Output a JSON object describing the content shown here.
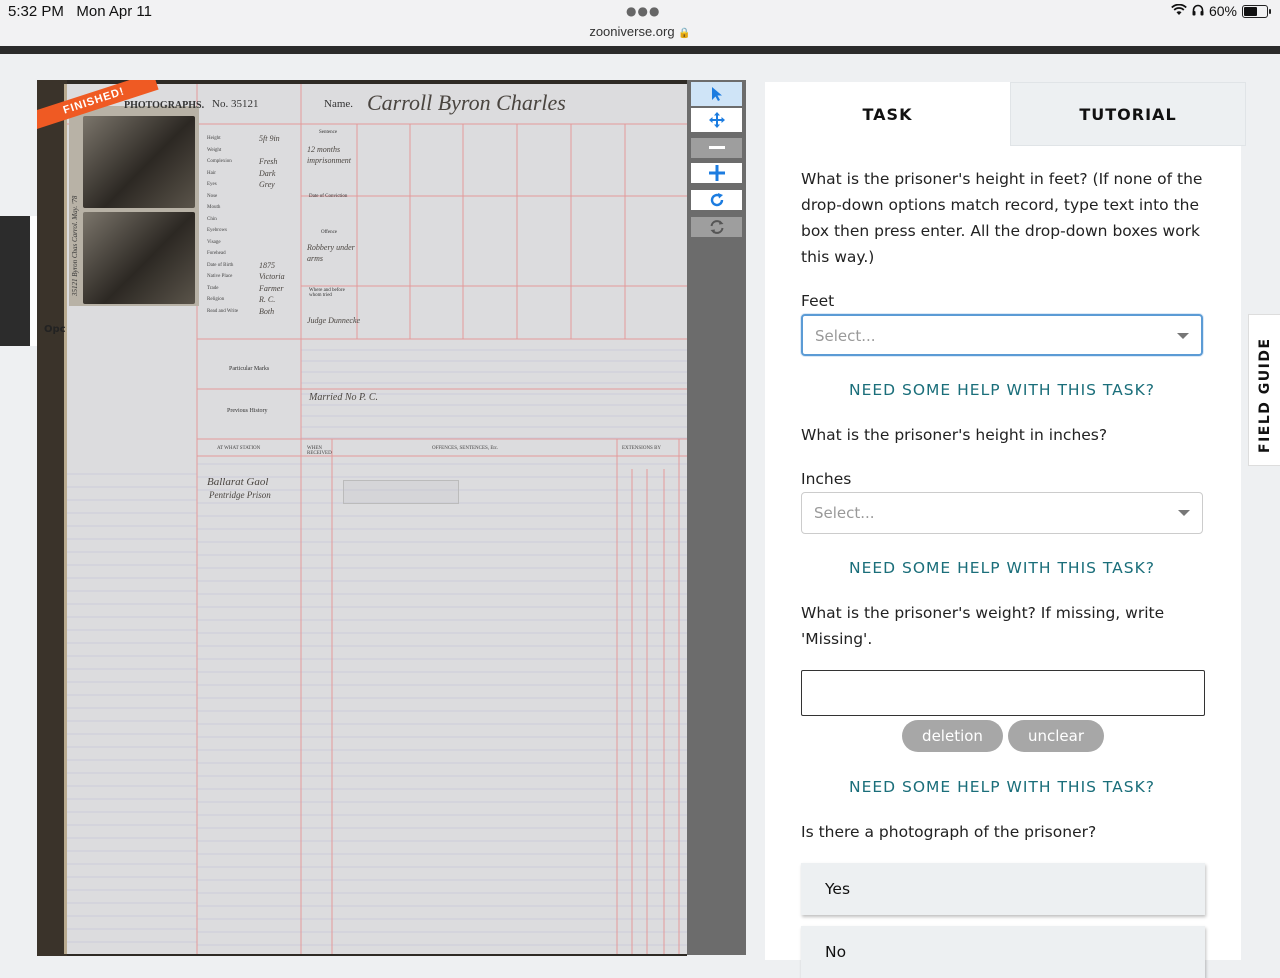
{
  "status_bar": {
    "time": "5:32 PM",
    "date": "Mon Apr 11",
    "url": "zooniverse.org",
    "battery": "60%",
    "icons": [
      "wifi-icon",
      "headphones-icon",
      "battery-icon",
      "lock-icon"
    ]
  },
  "subject": {
    "badge": "FINISHED!",
    "ledger": {
      "photographs_label": "PHOTOGRAPHS.",
      "number_label": "No.",
      "number_value": "35121",
      "name_label": "Name.",
      "name_value": "Carroll  Byron Charles",
      "field_labels": [
        "Height",
        "Weight",
        "Complexion",
        "Hair",
        "Eyes",
        "Nose",
        "Mouth",
        "Chin",
        "Eyebrows",
        "Visage",
        "Forehead",
        "Date of Birth",
        "Native Place",
        "Trade",
        "Religion",
        "Read and Write"
      ],
      "field_values": [
        "5ft 9in",
        "",
        "Fresh",
        "Dark",
        "Grey",
        "",
        "",
        "",
        "",
        "",
        "",
        "1875",
        "Victoria",
        "Farmer",
        "R. C.",
        "Both"
      ],
      "sentence_label": "Sentence",
      "sentence_value": "12 months imprisonment",
      "conviction_label": "Date of Conviction",
      "offence_label": "Offence",
      "offence_value": "Robbery under arms",
      "where_tried_label": "Where and before whom tried",
      "where_tried_value": "Judge Dunnecke",
      "particular_marks_label": "Particular Marks",
      "previous_history_label": "Previous History",
      "previous_history_value": "Married  No P. C.",
      "table_headers": [
        "AT WHAT STATION",
        "WHEN RECEIVED",
        "OFFENCES, SENTENCES, Etc.",
        "EXTENSIONS BY"
      ],
      "station_values": [
        "Ballarat Gaol",
        "Pentridge Prison"
      ],
      "side_text": "35121  Byron Chas Carrol.  May. '78",
      "edge_label": "Opc"
    }
  },
  "tools": [
    "pointer-icon",
    "move-icon",
    "zoom-out-icon",
    "zoom-in-icon",
    "rotate-icon",
    "reset-icon"
  ],
  "tabs": {
    "task": "TASK",
    "tutorial": "TUTORIAL"
  },
  "task": {
    "q1": "What is the prisoner's height in feet? (If none of the drop-down options match record, type text into the box then press enter. All the drop-down boxes work this way.)",
    "feet_label": "Feet",
    "feet_placeholder": "Select...",
    "help": "NEED SOME HELP WITH THIS TASK?",
    "q2": "What is the prisoner's height in inches?",
    "inches_label": "Inches",
    "inches_placeholder": "Select...",
    "q3": "What is the prisoner's weight? If missing, write 'Missing'.",
    "weight_value": "",
    "pill_deletion": "deletion",
    "pill_unclear": "unclear",
    "q4": "Is there a photograph of the prisoner?",
    "answers": [
      "Yes",
      "No"
    ]
  },
  "field_guide": "FIELD GUIDE"
}
